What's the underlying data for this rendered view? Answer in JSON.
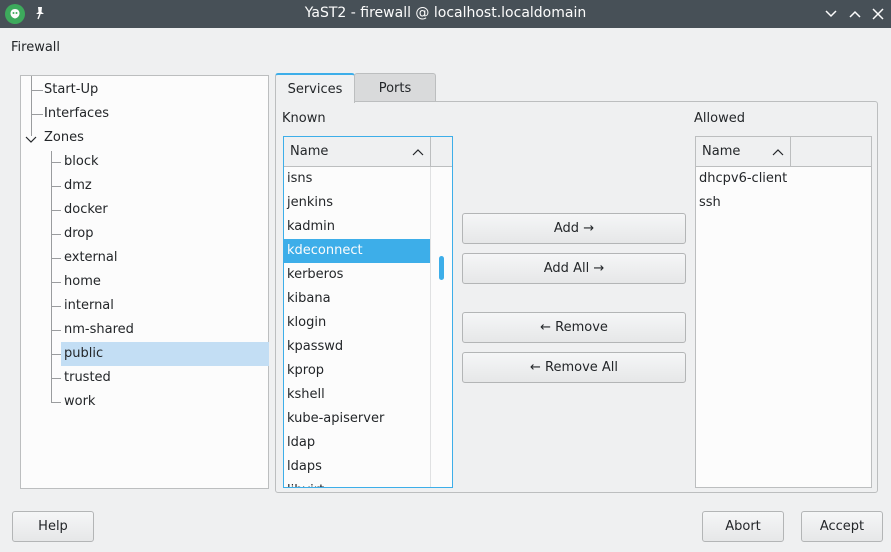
{
  "window": {
    "title": "YaST2 - firewall @ localhost.localdomain"
  },
  "heading": "Firewall",
  "tree": {
    "items": [
      "Start-Up",
      "Interfaces",
      "Zones"
    ],
    "zones": [
      "block",
      "dmz",
      "docker",
      "drop",
      "external",
      "home",
      "internal",
      "nm-shared",
      "public",
      "trusted",
      "work"
    ],
    "selected": "public"
  },
  "tabs": [
    {
      "label": "Services",
      "active": true
    },
    {
      "label": "Ports",
      "active": false
    }
  ],
  "known": {
    "label": "Known",
    "column": "Name",
    "rows": [
      "isns",
      "jenkins",
      "kadmin",
      "kdeconnect",
      "kerberos",
      "kibana",
      "klogin",
      "kpasswd",
      "kprop",
      "kshell",
      "kube-apiserver",
      "ldap",
      "ldaps",
      "libvirt"
    ],
    "selected_index": 3
  },
  "allowed": {
    "label": "Allowed",
    "column": "Name",
    "rows": [
      "dhcpv6-client",
      "ssh"
    ]
  },
  "actions": {
    "add": "Add →",
    "add_all": "Add All →",
    "remove": "← Remove",
    "remove_all": "← Remove All"
  },
  "footer": {
    "help": "Help",
    "abort": "Abort",
    "accept": "Accept"
  },
  "colors": {
    "accent": "#3daee9",
    "titlebar": "#475057",
    "tree_selected": "#c3def4"
  }
}
